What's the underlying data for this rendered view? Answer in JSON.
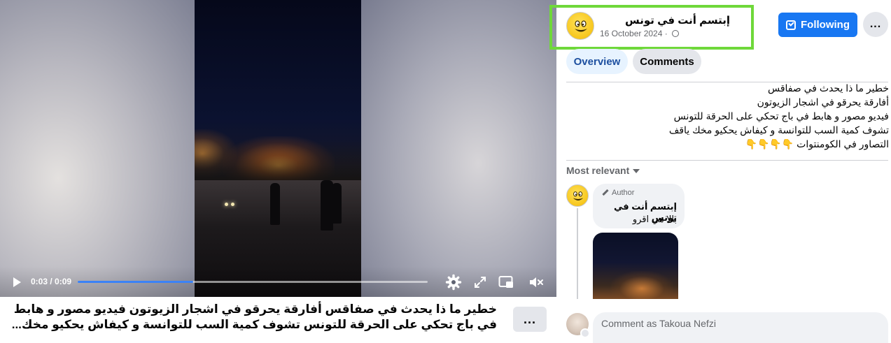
{
  "video": {
    "time_display": "0:03 / 0:09",
    "progress_fraction": 0.33
  },
  "caption": {
    "text": "خطير ما ذا يحدث في صفاقس أفارقة يحرقو في اشجار الزيوتون فيديو مصور و هابط في باج تحكي على الحرقة للتونس تشوف كمية السب للتوانسة و كيفاش يحكيو مخك...",
    "more_label": "..."
  },
  "post": {
    "page_name": "إبتسم أنت في تونس",
    "date": "16 October 2024 ·",
    "follow_label": "Following",
    "more_label": "...",
    "tabs": [
      {
        "label": "Overview",
        "active": true
      },
      {
        "label": "Comments",
        "active": false
      }
    ],
    "text_lines": [
      "خطير ما ذا يحدث في صفاقس",
      "أفارقة يحرقو في اشجار الزيوتون",
      "فيديو مصور و هابط في باج تحكي على الحرقة للتونس",
      "تشوف كمية السب للتوانسة و كيفاش يحكيو مخك ياقف",
      "التصاور في الكومنتوات 👇👇👇👇"
    ]
  },
  "comments": {
    "sort_label": "Most relevant",
    "items": [
      {
        "badge": "Author",
        "name": "إبتسم أنت في تونس",
        "text": "بالا هي اقرو"
      }
    ],
    "input_placeholder": "Comment as Takoua Nefzi"
  },
  "colors": {
    "accent": "#1877f2",
    "highlight_box": "#6fd83a",
    "tab_active_bg": "#e7f3ff"
  },
  "icons": {
    "play": "play-icon",
    "settings": "gear-icon",
    "fullscreen": "expand-icon",
    "miniplayer": "miniplayer-icon",
    "volume": "volume-muted-icon",
    "globe": "globe-icon",
    "follow": "check-box-icon",
    "pencil": "pencil-icon"
  }
}
